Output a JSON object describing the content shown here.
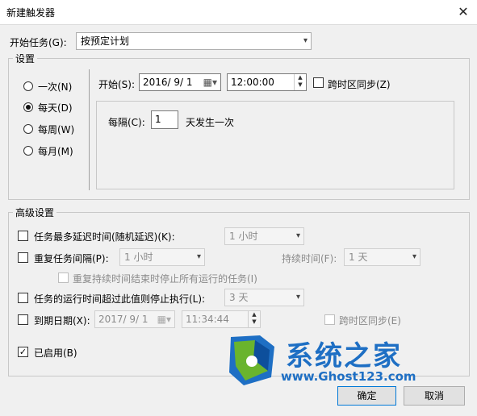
{
  "window": {
    "title": "新建触发器",
    "close_glyph": "✕"
  },
  "begin_task": {
    "label": "开始任务(G):",
    "value": "按预定计划",
    "arrow": "⌵"
  },
  "settings": {
    "group_label": "设置",
    "radios": [
      {
        "label": "一次(N)",
        "selected": false
      },
      {
        "label": "每天(D)",
        "selected": true
      },
      {
        "label": "每周(W)",
        "selected": false
      },
      {
        "label": "每月(M)",
        "selected": false
      }
    ],
    "start_label": "开始(S):",
    "start_date": "2016/ 9/ 1",
    "start_time": "12:00:00",
    "sync_tz_label": "跨时区同步(Z)",
    "recur_label": "每隔(C):",
    "recur_value": "1",
    "recur_suffix": "天发生一次"
  },
  "advanced": {
    "group_label": "高级设置",
    "delay": {
      "label": "任务最多延迟时间(随机延迟)(K):",
      "value": "1 小时"
    },
    "repeat": {
      "label": "重复任务间隔(P):",
      "value": "1 小时",
      "duration_label": "持续时间(F):",
      "duration_value": "1 天"
    },
    "stop_all": {
      "label": "重复持续时间结束时停止所有运行的任务(I)"
    },
    "stop_longer": {
      "label": "任务的运行时间超过此值则停止执行(L):",
      "value": "3 天"
    },
    "expire": {
      "label": "到期日期(X):",
      "date": "2017/ 9/ 1",
      "time": "11:34:44",
      "sync_label": "跨时区同步(E)"
    },
    "enabled": {
      "label": "已启用(B)",
      "checked": true
    }
  },
  "buttons": {
    "ok": "确定",
    "cancel": "取消"
  },
  "watermark": {
    "brand": "系统之家",
    "url": "www.Ghost123.com"
  },
  "colors": {
    "accent": "#0078d7",
    "brand_blue": "#1e6fc4",
    "brand_green": "#6ab42d"
  }
}
